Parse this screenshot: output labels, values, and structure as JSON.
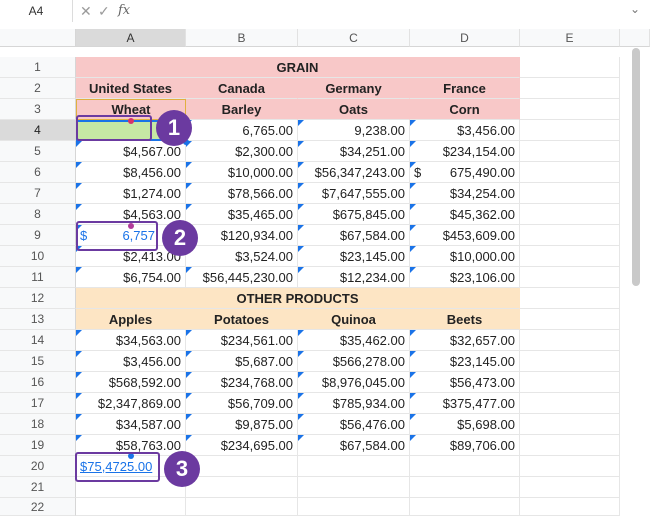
{
  "formula_bar": {
    "name_box": "A4",
    "cancel_icon": "✕",
    "confirm_icon": "✓",
    "function_icon": "fx",
    "expand_icon": "⌄"
  },
  "columns": [
    "A",
    "B",
    "C",
    "D",
    "E"
  ],
  "rows": [
    "1",
    "2",
    "3",
    "4",
    "5",
    "6",
    "7",
    "8",
    "9",
    "10",
    "11",
    "12",
    "13",
    "14",
    "15",
    "16",
    "17",
    "18",
    "19",
    "20",
    "21",
    "22"
  ],
  "cells": {
    "grain_title": "GRAIN",
    "r2": [
      "United States",
      "Canada",
      "Germany",
      "France"
    ],
    "r3": [
      "Wheat",
      "Barley",
      "Oats",
      "Corn"
    ],
    "r4": [
      "",
      "6,765.00",
      "9,238.00",
      "$3,456.00"
    ],
    "r5": [
      "$4,567.00",
      "$2,300.00",
      "$34,251.00",
      "$234,154.00"
    ],
    "r6": [
      "$8,456.00",
      "$10,000.00",
      "$56,347,243.00",
      "$",
      "675,490.00"
    ],
    "r7": [
      "$1,274.00",
      "$78,566.00",
      "$7,647,555.00",
      "$34,254.00"
    ],
    "r8": [
      "$4,563.00",
      "$35,465.00",
      "$675,845.00",
      "$45,362.00"
    ],
    "r9": [
      "$",
      "6,757",
      "$120,934.00",
      "$67,584.00",
      "$453,609.00"
    ],
    "r10": [
      "$2,413.00",
      "$3,524.00",
      "$23,145.00",
      "$10,000.00"
    ],
    "r11": [
      "$6,754.00",
      "$56,445,230.00",
      "$12,234.00",
      "$23,106.00"
    ],
    "other_title": "OTHER PRODUCTS",
    "r13": [
      "Apples",
      "Potatoes",
      "Quinoa",
      "Beets"
    ],
    "r14": [
      "$34,563.00",
      "$234,561.00",
      "$35,462.00",
      "$32,657.00"
    ],
    "r15": [
      "$3,456.00",
      "$5,687.00",
      "$566,278.00",
      "$23,145.00"
    ],
    "r16": [
      "$568,592.00",
      "$234,768.00",
      "$8,976,045.00",
      "$56,473.00"
    ],
    "r17": [
      "$2,347,869.00",
      "$56,709.00",
      "$785,934.00",
      "$375,477.00"
    ],
    "r18": [
      "$34,587.00",
      "$9,875.00",
      "$56,476.00",
      "$5,698.00"
    ],
    "r19": [
      "$58,763.00",
      "$234,695.00",
      "$67,584.00",
      "$89,706.00"
    ],
    "r20": [
      "$75,4725.00"
    ]
  },
  "badges": [
    "1",
    "2",
    "3"
  ],
  "colors": {
    "accent": "#6b3aa0",
    "header_pink": "#f8c8c8",
    "header_cream": "#fde5c4",
    "selection_green": "#c6e8a4",
    "link_blue": "#1a73e8"
  }
}
